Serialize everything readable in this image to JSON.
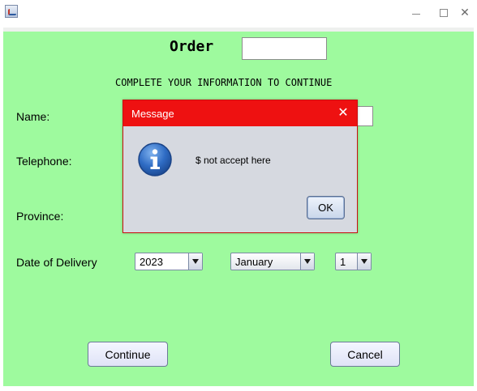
{
  "window": {
    "minimize_glyph": "",
    "close_glyph": "✕"
  },
  "form": {
    "title": "Order",
    "order_value": "",
    "subtitle": "COMPLETE YOUR INFORMATION TO CONTINUE",
    "labels": {
      "name": "Name:",
      "telephone": "Telephone:",
      "province": "Province:",
      "date_of_delivery": "Date of Delivery"
    },
    "date": {
      "year": "2023",
      "month": "January",
      "day": "1"
    },
    "buttons": {
      "continue": "Continue",
      "cancel": "Cancel"
    }
  },
  "dialog": {
    "title": "Message",
    "close_glyph": "✕",
    "message": "$ not accept here",
    "ok": "OK",
    "icon": "info-icon"
  },
  "colors": {
    "background": "#9efa9e",
    "dialog_title": "#ee1111",
    "dialog_body": "#d6d9e0"
  }
}
